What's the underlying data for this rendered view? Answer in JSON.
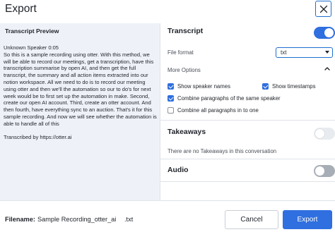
{
  "dialog": {
    "title": "Export",
    "close_icon": "close-icon"
  },
  "preview": {
    "title": "Transcript Preview",
    "speaker_line": "Unknown Speaker  0:05",
    "body": "So this is a sample recording using otter. With this method, we will be able to record our meetings, get a transcription, have this transcription summarise by open AI, and then get the full transcript, the summary and all action items extracted into our notion workspace. All we need to do is to record our meeting using otter and then we'll the automation so our to do's for next week would be to first set up the automation in make. Second, create our open AI account. Third, create an otter account. And then fourth, have everything sync to an auction. That's it for this sample recording. And now we will see whether the automation is able to handle all of this",
    "footer_line": "Transcribed by https://otter.ai"
  },
  "transcript": {
    "title": "Transcript",
    "enabled": true,
    "file_format_label": "File format",
    "file_format_value": "txt",
    "more_options_label": "More Options",
    "options": [
      {
        "label": "Show speaker names",
        "checked": true
      },
      {
        "label": "Show timestamps",
        "checked": true
      },
      {
        "label": "Combine paragraphs of the same speaker",
        "checked": true
      },
      {
        "label": "Combine all paragraphs in to one",
        "checked": false
      }
    ]
  },
  "takeaways": {
    "title": "Takeaways",
    "enabled": false,
    "empty_note": "There are no Takeaways in this conversation"
  },
  "audio": {
    "title": "Audio",
    "enabled": false
  },
  "footer": {
    "filename_label": "Filename:",
    "filename_value": "Sample Recording_otter_ai",
    "extension": ".txt",
    "cancel_label": "Cancel",
    "export_label": "Export"
  },
  "colors": {
    "accent": "#2f6fdf",
    "preview_bg": "#eef2f8"
  }
}
